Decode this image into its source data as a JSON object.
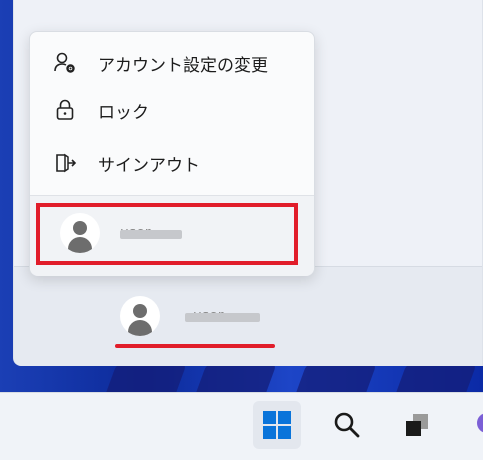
{
  "colors": {
    "highlight_red": "#e11d2a",
    "panel_bg": "#eef1f7",
    "flyout_bg": "#fafbfc",
    "windows_blue": "#0a74da"
  },
  "account_menu": {
    "items": [
      {
        "label": "アカウント設定の変更",
        "icon": "account-settings-icon"
      },
      {
        "label": "ロック",
        "icon": "lock-icon"
      },
      {
        "label": "サインアウト",
        "icon": "sign-out-icon"
      }
    ],
    "other_account_name": "user"
  },
  "start_footer": {
    "current_user_name": "user"
  },
  "taskbar": {
    "items": [
      {
        "name": "start",
        "icon": "windows-start-icon"
      },
      {
        "name": "search",
        "icon": "search-icon"
      },
      {
        "name": "task-view",
        "icon": "task-view-icon"
      },
      {
        "name": "chat",
        "icon": "chat-icon"
      }
    ]
  }
}
